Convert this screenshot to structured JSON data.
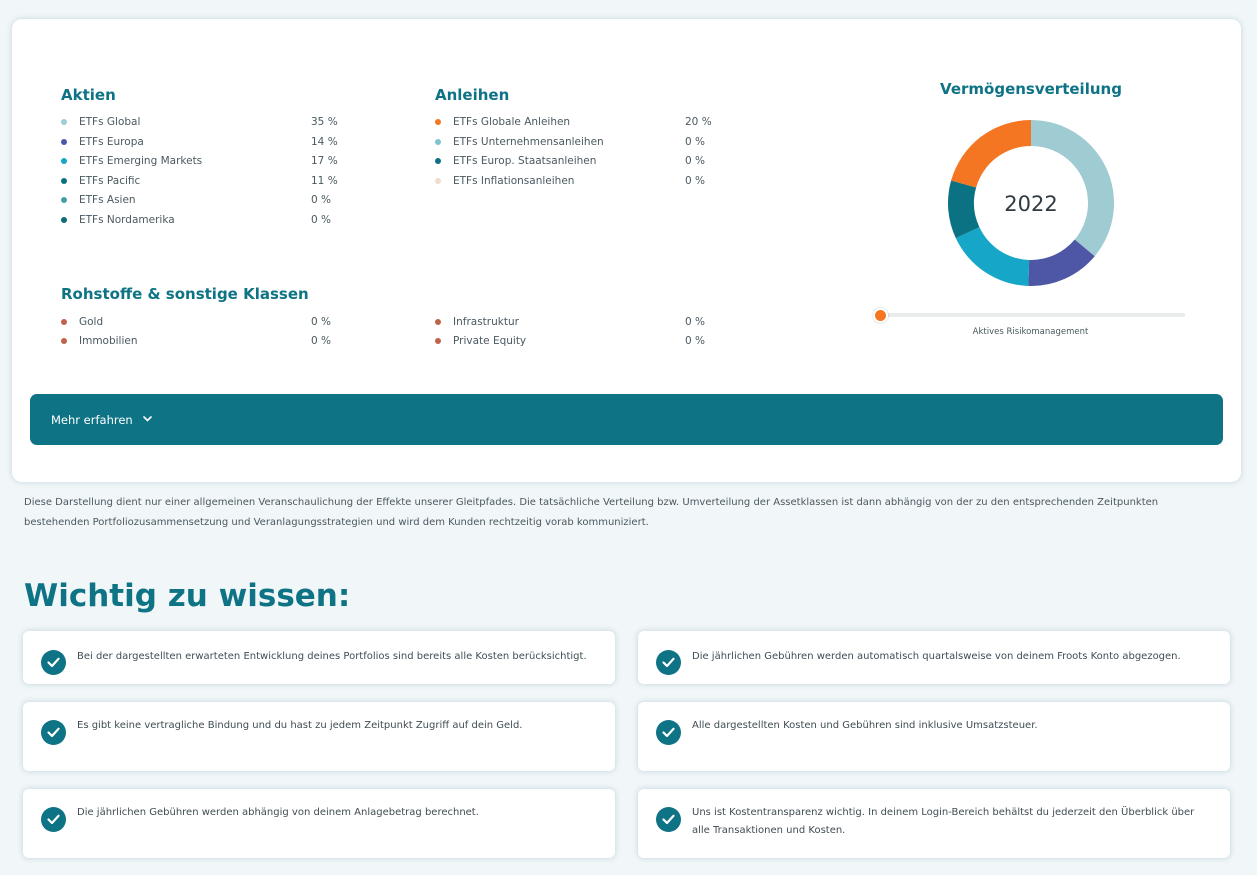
{
  "allocation": {
    "aktien": {
      "title": "Aktien",
      "items": [
        {
          "label": "ETFs Global",
          "pct": "35 %",
          "color": "#9fcbd3"
        },
        {
          "label": "ETFs Europa",
          "pct": "14 %",
          "color": "#4e56a6"
        },
        {
          "label": "ETFs Emerging Markets",
          "pct": "17 %",
          "color": "#16a6c7"
        },
        {
          "label": "ETFs Pacific",
          "pct": "11 %",
          "color": "#0b7283"
        },
        {
          "label": "ETFs Asien",
          "pct": "0 %",
          "color": "#4b9bab"
        },
        {
          "label": "ETFs Nordamerika",
          "pct": "0 %",
          "color": "#0e6b7b"
        }
      ]
    },
    "anleihen": {
      "title": "Anleihen",
      "items": [
        {
          "label": "ETFs Globale Anleihen",
          "pct": "20 %",
          "color": "#f47622"
        },
        {
          "label": "ETFs Unternehmensanleihen",
          "pct": "0 %",
          "color": "#80c2d0"
        },
        {
          "label": "ETFs Europ. Staatsanleihen",
          "pct": "0 %",
          "color": "#116f85"
        },
        {
          "label": "ETFs Inflationsanleihen",
          "pct": "0 %",
          "color": "#f3dccd"
        }
      ]
    },
    "rohstoffe": {
      "title": "Rohstoffe & sonstige Klassen",
      "items": [
        {
          "label": "Gold",
          "pct": "0 %",
          "color": "#c0634a"
        },
        {
          "label": "Immobilien",
          "pct": "0 %",
          "color": "#c0634a"
        },
        {
          "label": "Infrastruktur",
          "pct": "0 %",
          "color": "#c0634a"
        },
        {
          "label": "Private Equity",
          "pct": "0 %",
          "color": "#c0634a"
        }
      ]
    }
  },
  "chart": {
    "title": "Vermögensverteilung",
    "center_label": "2022",
    "slices": [
      {
        "name": "ETFs Global",
        "value": 35,
        "color": "#9fcbd3"
      },
      {
        "name": "ETFs Europa",
        "value": 14,
        "color": "#4e56a6"
      },
      {
        "name": "ETFs Emerging Markets",
        "value": 17,
        "color": "#16a6c7"
      },
      {
        "name": "ETFs Pacific",
        "value": 11,
        "color": "#0b7283"
      },
      {
        "name": "ETFs Globale Anleihen",
        "value": 20,
        "color": "#f47622"
      }
    ]
  },
  "slider": {
    "label": "Aktives Risikomanagement",
    "value": 0
  },
  "more_button": {
    "label": "Mehr erfahren",
    "icon": "chevron-down-icon"
  },
  "disclaimer": "Diese Darstellung dient nur einer allgemeinen Veranschaulichung der Effekte unserer Gleitpfades. Die tatsächliche Verteilung bzw. Umverteilung der Assetklassen ist dann abhängig von der zu den entsprechenden Zeitpunkten bestehenden Portfoliozusammensetzung und Veranlagungsstrategien und wird dem Kunden rechtzeitig vorab kommuniziert.",
  "wichtig": {
    "title": "Wichtig zu wissen:",
    "items": [
      "Bei der dargestellten erwarteten Entwicklung deines Portfolios sind bereits alle Kosten berücksichtigt.",
      "Die jährlichen Gebühren werden automatisch quartalsweise von deinem Froots Konto abgezogen.",
      "Es gibt keine vertragliche Bindung und du hast zu jedem Zeitpunkt Zugriff auf dein Geld.",
      "Alle dargestellten Kosten und Gebühren sind inklusive Umsatzsteuer.",
      "Die jährlichen Gebühren werden abhängig von deinem Anlagebetrag berechnet.",
      "Uns ist Kostentransparenz wichtig. In deinem Login-Bereich behältst du jederzeit den Überblick über alle Transaktionen und Kosten."
    ]
  },
  "colors": {
    "brand": "#0d7385",
    "background": "#f1f6f8"
  }
}
